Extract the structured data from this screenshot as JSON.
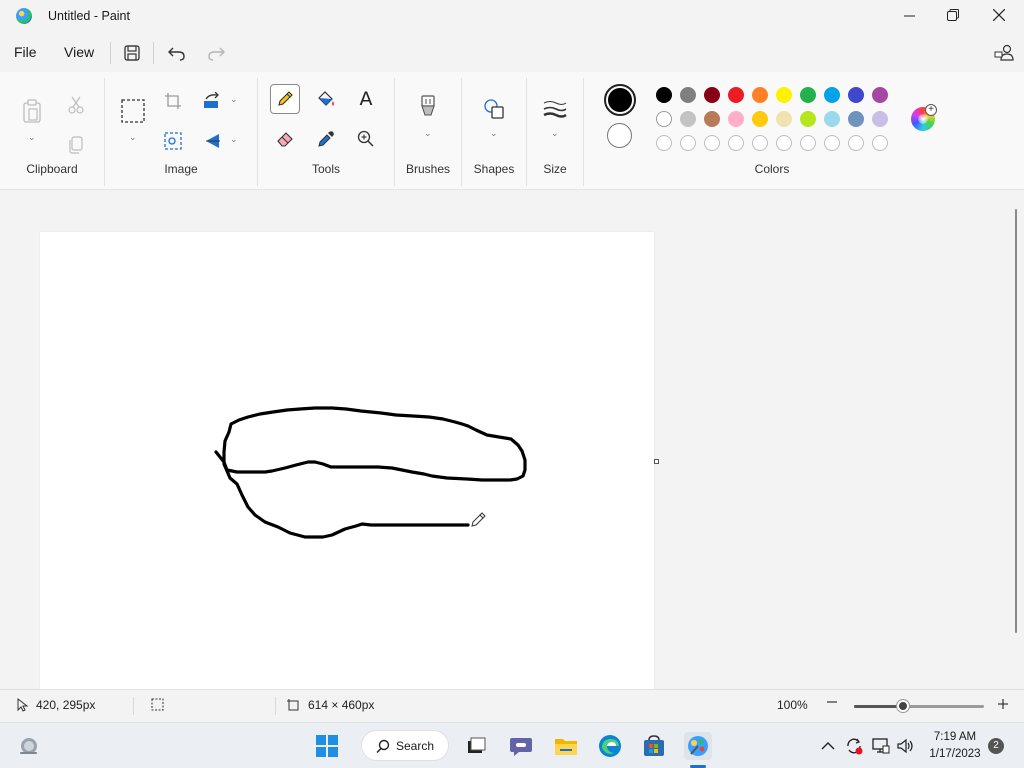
{
  "window": {
    "title": "Untitled - Paint",
    "minimize_glyph": "—",
    "maximize_glyph": "❐",
    "close_glyph": "✕"
  },
  "menu": {
    "file_label": "File",
    "view_label": "View"
  },
  "ribbon": {
    "groups": {
      "clipboard": "Clipboard",
      "image": "Image",
      "tools": "Tools",
      "brushes": "Brushes",
      "shapes": "Shapes",
      "size": "Size",
      "colors": "Colors"
    },
    "text_tool_glyph": "A",
    "selected_tool": "pencil-icon"
  },
  "colors": {
    "primary": "#000000",
    "secondary": "#ffffff",
    "palette_row1": [
      "#000000",
      "#7f7f7f",
      "#880015",
      "#ed1c24",
      "#ff7f27",
      "#fff200",
      "#22b14c",
      "#00a2e8",
      "#3f48cc",
      "#a349a4"
    ],
    "palette_row2": [
      "#ffffff",
      "#c3c3c3",
      "#b97a57",
      "#ffaec9",
      "#ffc90e",
      "#efe4b0",
      "#b5e61d",
      "#99d9ea",
      "#7092be",
      "#c8bfe7"
    ],
    "custom_slots": 10
  },
  "status": {
    "cursor_position": "420, 295px",
    "canvas_size": "614 × 460px",
    "zoom_level": "100%",
    "zoom_fraction": 0.38
  },
  "taskbar": {
    "search_label": "Search",
    "time": "7:19 AM",
    "date": "1/17/2023",
    "notification_count": "2"
  }
}
